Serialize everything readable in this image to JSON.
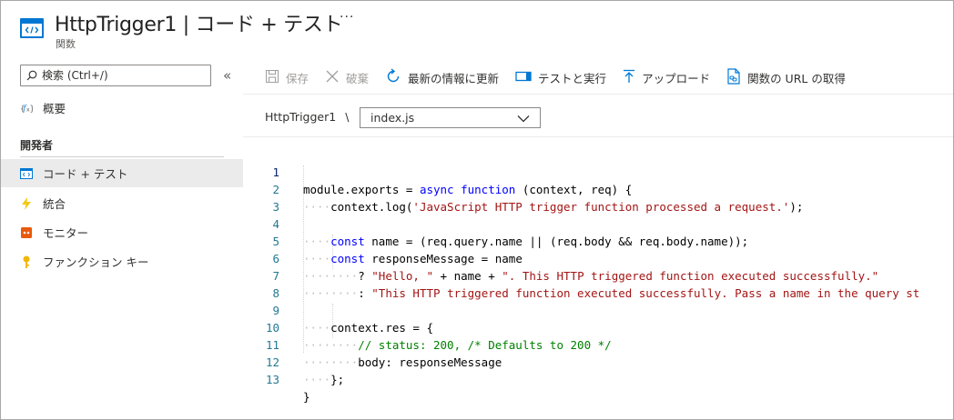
{
  "header": {
    "title": "HttpTrigger1 | コード + テスト",
    "subtitle": "関数",
    "more": "···"
  },
  "sidebar": {
    "search_placeholder": "検索 (Ctrl+/)",
    "collapse": "«",
    "overview": "概要",
    "section": "開発者",
    "items": [
      {
        "label": "コード + テスト",
        "icon": "code-icon",
        "active": true
      },
      {
        "label": "統合",
        "icon": "lightning-icon"
      },
      {
        "label": "モニター",
        "icon": "monitor-icon"
      },
      {
        "label": "ファンクション キー",
        "icon": "key-icon"
      }
    ]
  },
  "toolbar": {
    "save": "保存",
    "discard": "破棄",
    "refresh": "最新の情報に更新",
    "test_run": "テストと実行",
    "upload": "アップロード",
    "get_url": "関数の URL の取得"
  },
  "breadcrumb": {
    "function": "HttpTrigger1",
    "separator": "\\",
    "file": "index.js"
  },
  "code_lines": [
    {
      "n": "1",
      "text": "module.exports = async function (context, req) {"
    },
    {
      "n": "2",
      "text": "    context.log('JavaScript HTTP trigger function processed a request.');"
    },
    {
      "n": "3",
      "text": ""
    },
    {
      "n": "4",
      "text": "    const name = (req.query.name || (req.body && req.body.name));"
    },
    {
      "n": "5",
      "text": "    const responseMessage = name"
    },
    {
      "n": "6",
      "text": "        ? \"Hello, \" + name + \". This HTTP triggered function executed successfully.\""
    },
    {
      "n": "7",
      "text": "        : \"This HTTP triggered function executed successfully. Pass a name in the query st"
    },
    {
      "n": "8",
      "text": ""
    },
    {
      "n": "9",
      "text": "    context.res = {"
    },
    {
      "n": "10",
      "text": "        // status: 200, /* Defaults to 200 */"
    },
    {
      "n": "11",
      "text": "        body: responseMessage"
    },
    {
      "n": "12",
      "text": "    };"
    },
    {
      "n": "13",
      "text": "}"
    }
  ],
  "colors": {
    "accent": "#0078d4",
    "keyword": "#0000ff",
    "string": "#a31515",
    "comment": "#008000",
    "line_number": "#237893"
  }
}
